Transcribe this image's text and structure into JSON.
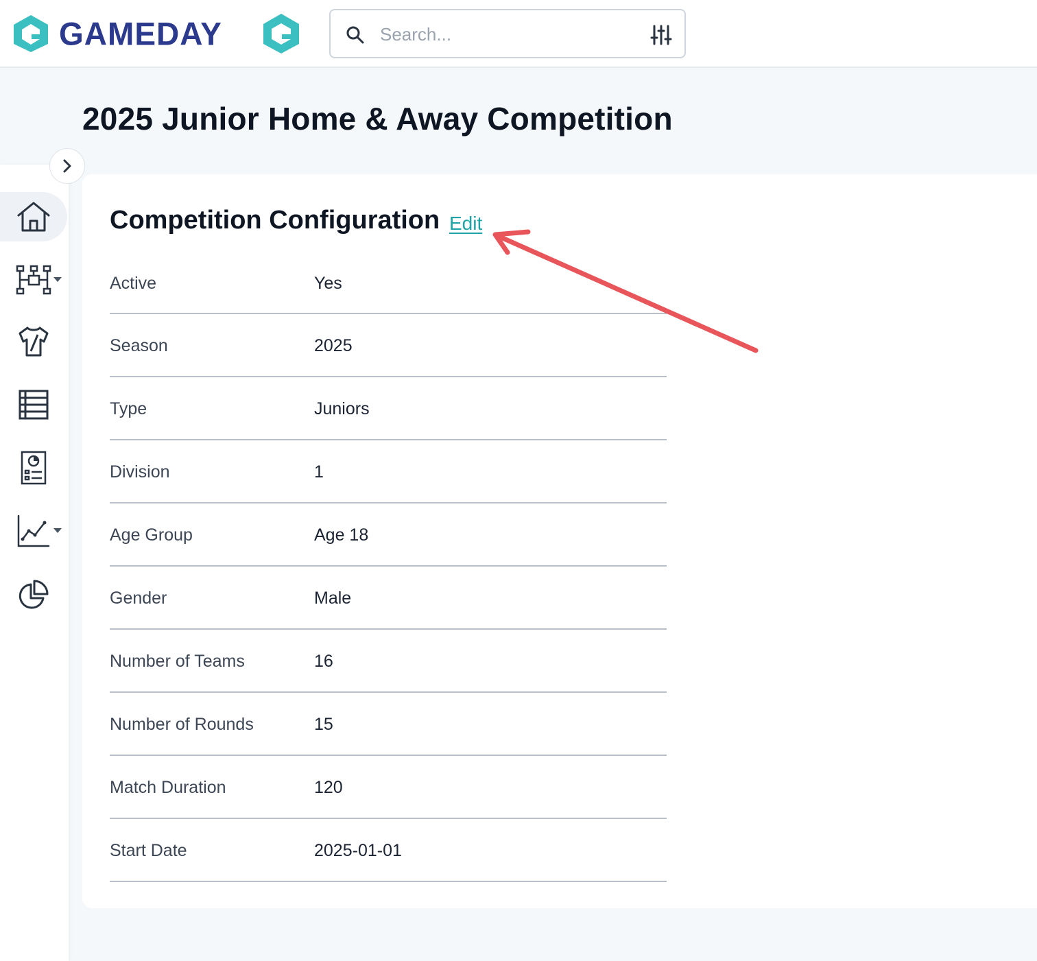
{
  "header": {
    "brand_name": "GAMEDAY",
    "search": {
      "placeholder": "Search..."
    },
    "brand_color": "#2b3a8c",
    "accent_color": "#3bbfc0"
  },
  "sidebar": {
    "items": [
      {
        "icon": "home-icon",
        "active": true
      },
      {
        "icon": "org-structure-icon",
        "has_dropdown": true
      },
      {
        "icon": "jersey-icon"
      },
      {
        "icon": "table-icon"
      },
      {
        "icon": "report-icon"
      },
      {
        "icon": "line-chart-icon",
        "has_dropdown": true
      },
      {
        "icon": "pie-chart-icon"
      }
    ]
  },
  "page": {
    "title": "2025 Junior Home & Away Competition"
  },
  "config": {
    "title": "Competition Configuration",
    "edit_label": "Edit",
    "rows": [
      {
        "label": "Active",
        "value": "Yes"
      },
      {
        "label": "Season",
        "value": "2025"
      },
      {
        "label": "Type",
        "value": "Juniors"
      },
      {
        "label": "Division",
        "value": "1"
      },
      {
        "label": "Age Group",
        "value": "Age 18"
      },
      {
        "label": "Gender",
        "value": "Male"
      },
      {
        "label": "Number of Teams",
        "value": "16"
      },
      {
        "label": "Number of Rounds",
        "value": "15"
      },
      {
        "label": "Match Duration",
        "value": "120"
      },
      {
        "label": "Start Date",
        "value": "2025-01-01"
      }
    ]
  },
  "annotation_color": "#e8555a"
}
